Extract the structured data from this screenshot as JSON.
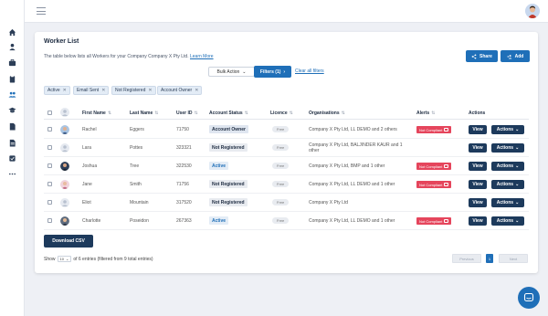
{
  "sidebar": {
    "icons": [
      "home-icon",
      "user-icon",
      "briefcase-icon",
      "clipboard-icon",
      "users-icon",
      "graduation-cap-icon",
      "file-icon",
      "document-icon",
      "checklist-icon",
      "more-icon"
    ]
  },
  "header": {
    "menu_icon": "hamburger-icon",
    "avatar": "user-avatar"
  },
  "page": {
    "title": "Worker List",
    "description": "The table below lists all Workers for your Company Company X Pty Ltd.",
    "learn_more": "Learn More",
    "share_label": "Share",
    "add_label": "Add"
  },
  "toolbar": {
    "bulk_action": "Bulk Action",
    "filters_label": "Filters (1)",
    "clear_filters": "Clear all filters"
  },
  "chips": [
    "Active",
    "Email Sent",
    "Not Registered",
    "Account Owner"
  ],
  "table": {
    "columns": [
      "First Name",
      "Last Name",
      "User ID",
      "Account Status",
      "Licence",
      "Organisations",
      "Alerts",
      "Actions"
    ],
    "rows": [
      {
        "first": "Rachel",
        "last": "Eggers",
        "id": "71750",
        "status": "Account Owner",
        "licence": "Free",
        "org": "Company X Pty Ltd, LL DEMO and 2 others",
        "alert": "Not Compliant",
        "view": "View",
        "actions": "Actions"
      },
      {
        "first": "Lara",
        "last": "Pottes",
        "id": "323321",
        "status": "Not Registered",
        "licence": "Free",
        "org": "Company X Pty Ltd, BALJINDER KAUR and 1 other",
        "alert": "",
        "view": "View",
        "actions": "Actions"
      },
      {
        "first": "Joshua",
        "last": "Tree",
        "id": "322530",
        "status": "Active",
        "licence": "Free",
        "org": "Company X Pty Ltd, BMP and 1 other",
        "alert": "Not Compliant",
        "view": "View",
        "actions": "Actions"
      },
      {
        "first": "Jane",
        "last": "Smith",
        "id": "71756",
        "status": "Not Registered",
        "licence": "Free",
        "org": "Company X Pty Ltd, LL DEMO and 1 other",
        "alert": "Not Compliant",
        "view": "View",
        "actions": "Actions"
      },
      {
        "first": "Eliot",
        "last": "Mountain",
        "id": "317520",
        "status": "Not Registered",
        "licence": "Free",
        "org": "Company X Pty Ltd",
        "alert": "",
        "view": "View",
        "actions": "Actions"
      },
      {
        "first": "Charlotte",
        "last": "Poseidon",
        "id": "267363",
        "status": "Active",
        "licence": "Free",
        "org": "Company X Pty Ltd, LL DEMO and 1 other",
        "alert": "Not Compliant",
        "view": "View",
        "actions": "Actions"
      }
    ]
  },
  "footer": {
    "download_csv": "Download CSV",
    "show": "Show",
    "page_size": "10",
    "entries_text": "of 6 entries (filtered from 9 total entries)",
    "previous": "Previous",
    "page": "1",
    "next": "Next"
  },
  "colors": {
    "primary": "#1f6fb8",
    "dark": "#1d3a5c",
    "alert": "#e5455c"
  }
}
